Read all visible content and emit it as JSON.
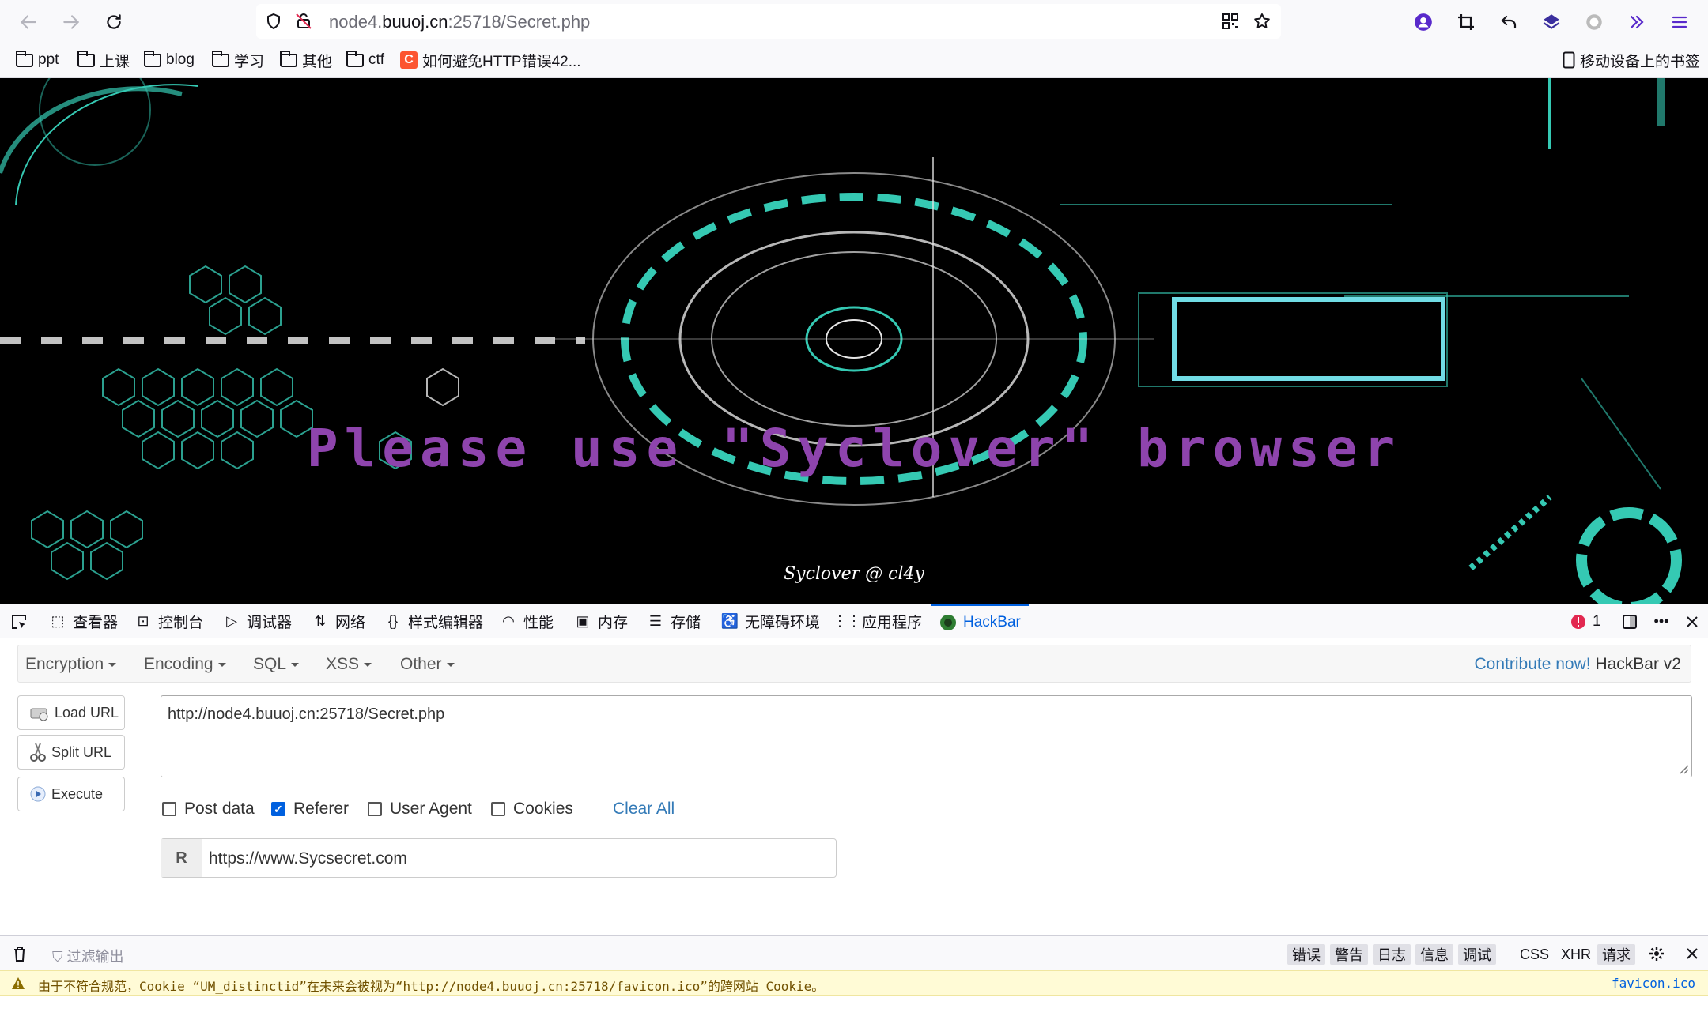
{
  "browser": {
    "url_prefix": "node4.",
    "url_host": "buuoj.cn",
    "url_suffix": ":25718/Secret.php"
  },
  "bookmarks": [
    {
      "label": "ppt",
      "icon": "folder-icon"
    },
    {
      "label": "上课",
      "icon": "folder-icon"
    },
    {
      "label": "blog",
      "icon": "folder-icon"
    },
    {
      "label": "学习",
      "icon": "folder-icon"
    },
    {
      "label": "其他",
      "icon": "folder-icon"
    },
    {
      "label": "ctf",
      "icon": "folder-icon"
    },
    {
      "label": "如何避免HTTP错误42...",
      "icon": "csdn-icon"
    }
  ],
  "bookmarks_mobile": "移动设备上的书签",
  "page": {
    "title": "Please use \"Syclover\" browser",
    "signature": "Syclover @ cl4y",
    "accent": "#8e44ad",
    "background": "#000000"
  },
  "devtools": {
    "tabs": [
      "查看器",
      "控制台",
      "调试器",
      "网络",
      "样式编辑器",
      "性能",
      "内存",
      "存储",
      "无障碍环境",
      "应用程序",
      "HackBar"
    ],
    "error_count": "1"
  },
  "hackbar": {
    "menus": [
      "Encryption",
      "Encoding",
      "SQL",
      "XSS",
      "Other"
    ],
    "contribute": "Contribute now!",
    "version": "HackBar v2",
    "buttons": [
      "Load URL",
      "Split URL",
      "Execute"
    ],
    "url_value": "http://node4.buuoj.cn:25718/Secret.php",
    "options": [
      {
        "label": "Post data",
        "checked": false
      },
      {
        "label": "Referer",
        "checked": true
      },
      {
        "label": "User Agent",
        "checked": false
      },
      {
        "label": "Cookies",
        "checked": false
      }
    ],
    "clear_all": "Clear All",
    "referer_addon": "R",
    "referer_value": "https://www.Sycsecret.com"
  },
  "console": {
    "filter_placeholder": "过滤输出",
    "levels": [
      "错误",
      "警告",
      "日志",
      "信息",
      "调试"
    ],
    "types": [
      "CSS",
      "XHR",
      "请求"
    ],
    "warning": "由于不符合规范，Cookie “UM_distinctid”在未来会被视为“http://node4.buuoj.cn:25718/favicon.ico”的跨网站 Cookie。",
    "warning_source": "favicon.ico"
  }
}
